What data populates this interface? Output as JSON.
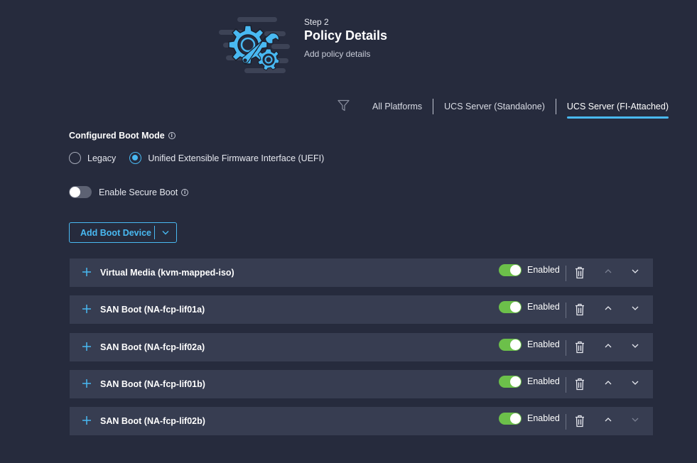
{
  "header": {
    "step": "Step 2",
    "title": "Policy Details",
    "subtitle": "Add policy details"
  },
  "platform_tabs": [
    {
      "label": "All Platforms",
      "active": false
    },
    {
      "label": "UCS Server (Standalone)",
      "active": false
    },
    {
      "label": "UCS Server (FI-Attached)",
      "active": true
    }
  ],
  "boot_mode": {
    "label": "Configured Boot Mode",
    "options": [
      {
        "label": "Legacy",
        "selected": false
      },
      {
        "label": "Unified Extensible Firmware Interface (UEFI)",
        "selected": true
      }
    ]
  },
  "secure_boot": {
    "label": "Enable Secure Boot",
    "enabled": false
  },
  "add_boot_device": {
    "label": "Add Boot Device"
  },
  "boot_devices": [
    {
      "name": "Virtual Media (kvm-mapped-iso)",
      "status": "Enabled"
    },
    {
      "name": "SAN Boot (NA-fcp-lif01a)",
      "status": "Enabled"
    },
    {
      "name": "SAN Boot (NA-fcp-lif02a)",
      "status": "Enabled"
    },
    {
      "name": "SAN Boot (NA-fcp-lif01b)",
      "status": "Enabled"
    },
    {
      "name": "SAN Boot (NA-fcp-lif02b)",
      "status": "Enabled"
    }
  ],
  "colors": {
    "background": "#262b3d",
    "row": "#373d51",
    "accent": "#49b9f2",
    "toggle_on": "#6cc04a"
  },
  "icons": {
    "hero": "gear-wrench-icon",
    "filter": "filter-icon",
    "info": "info-icon",
    "expand": "plus-icon",
    "delete": "trash-icon",
    "move_up": "chevron-up-icon",
    "move_down": "chevron-down-icon"
  }
}
